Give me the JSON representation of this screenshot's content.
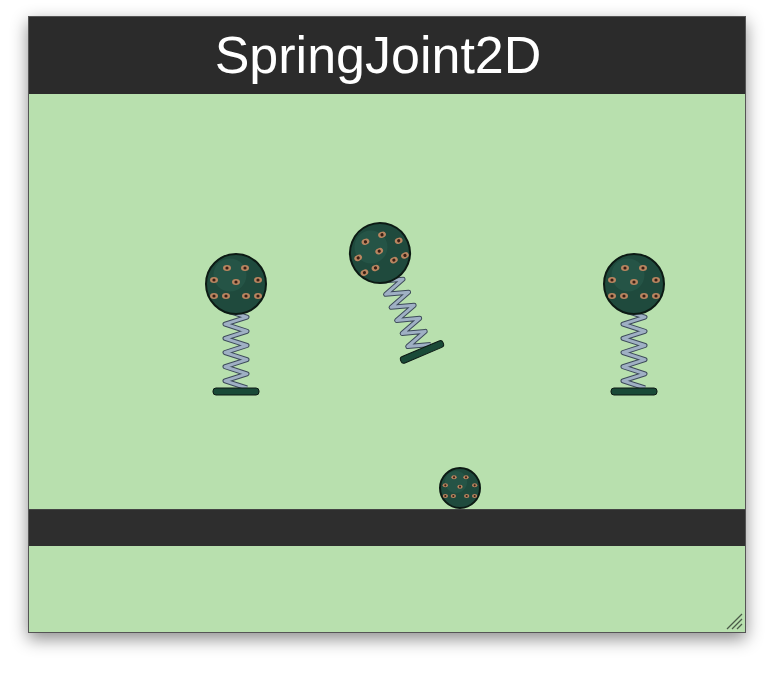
{
  "window": {
    "title": "SpringJoint2D"
  }
}
